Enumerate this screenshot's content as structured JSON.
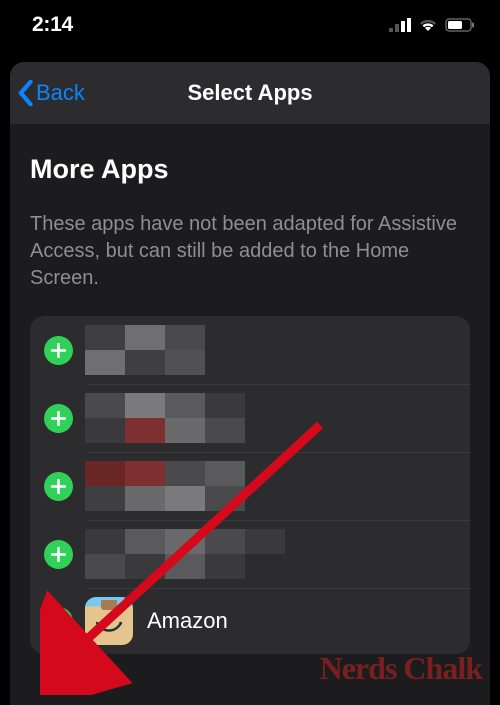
{
  "status": {
    "time": "2:14"
  },
  "nav": {
    "back_label": "Back",
    "title": "Select Apps"
  },
  "section": {
    "title": "More Apps",
    "description": "These apps have not been adapted for Assistive Access, but can still be added to the Home Screen."
  },
  "apps": {
    "redacted_count": 4,
    "visible": {
      "name": "Amazon"
    }
  },
  "watermark": "Nerds Chalk",
  "colors": {
    "accent": "#0a84ff",
    "add_green": "#30d158",
    "arrow": "#d4091b"
  }
}
